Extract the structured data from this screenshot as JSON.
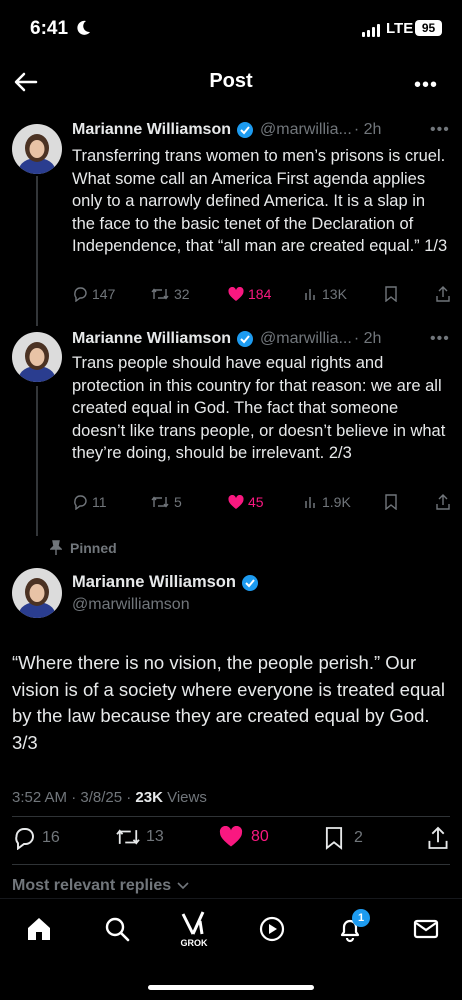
{
  "status": {
    "time": "6:41",
    "network": "LTE",
    "battery": "95"
  },
  "nav": {
    "title": "Post"
  },
  "thread": [
    {
      "name": "Marianne Williamson",
      "handle": "@marwillia...",
      "time": "· 2h",
      "text": "Transferring trans women to men’s prisons is cruel. What some call an America First agenda applies only to a narrowly defined America. It is a slap in the face to the basic tenet of the Declaration of Independence, that “all man are created equal.” 1/3",
      "replies": "147",
      "reposts": "32",
      "likes": "184",
      "views": "13K"
    },
    {
      "name": "Marianne Williamson",
      "handle": "@marwillia...",
      "time": "· 2h",
      "text": "Trans people should have equal rights and protection in this country for that reason: we are all created equal in God. The fact that someone doesn’t like trans people, or doesn’t believe in what they’re doing, should be irrelevant. 2/3",
      "replies": "11",
      "reposts": "5",
      "likes": "45",
      "views": "1.9K"
    }
  ],
  "main_post": {
    "pinned_label": "Pinned",
    "name": "Marianne Williamson",
    "handle": "@marwilliamson",
    "text": "“Where there is no vision, the people perish.” Our vision is of a society where everyone is treated equal by the law because they are created equal by God. 3/3",
    "timestamp": "3:52 AM · 3/8/25 · ",
    "views_count": "23K",
    "views_label": " Views",
    "replies": "16",
    "reposts": "13",
    "likes": "80",
    "bookmarks": "2"
  },
  "replies_sort_label": "Most relevant replies",
  "bottom_nav": {
    "grok_label": "GROK",
    "notification_count": "1"
  },
  "colors": {
    "accent": "#1d9bf0",
    "like": "#f91880",
    "muted": "#71767b",
    "background": "#000000"
  }
}
